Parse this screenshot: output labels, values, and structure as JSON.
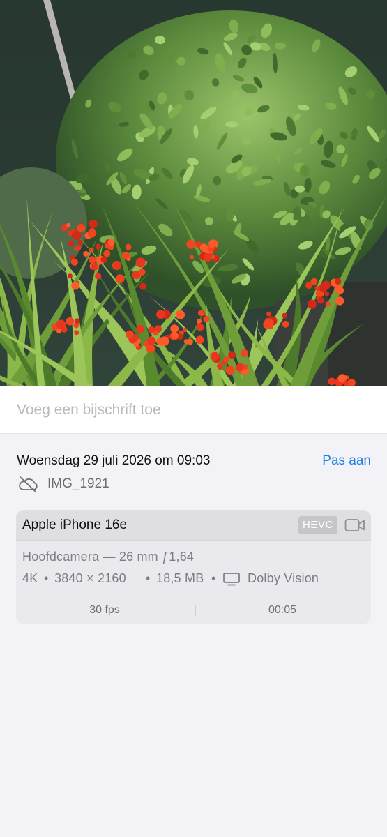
{
  "photo": {
    "subject": "photo-thumbnail"
  },
  "caption": {
    "placeholder": "Voeg een bijschrift toe"
  },
  "info": {
    "date_time": "Woensdag 29 juli 2026 om 09:03",
    "adjust_label": "Pas aan",
    "file_name": "IMG_1921",
    "cloud_icon": "cloud-slash-icon"
  },
  "camera_card": {
    "device": "Apple iPhone 16e",
    "codec": "HEVC",
    "video_icon": "video-camera-icon",
    "lens": "Hoofdcamera — 26 mm ƒ1,64",
    "spec": {
      "quality": "4K",
      "resolution": "3840 × 2160",
      "size": "18,5 MB",
      "display_icon": "display-icon",
      "hdr": "Dolby Vision",
      "separator": "•"
    },
    "fps": "30 fps",
    "duration": "00:05"
  },
  "colors": {
    "accent": "#1a7ee6",
    "secondary_text": "#7c7c82",
    "card_bg": "#e9e9ee"
  }
}
